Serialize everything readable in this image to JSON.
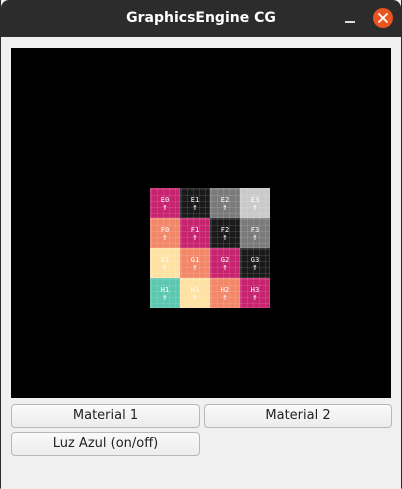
{
  "window": {
    "title": "GraphicsEngine CG"
  },
  "buttons": {
    "material1": "Material 1",
    "material2": "Material 2",
    "luz_azul": "Luz Azul (on/off)"
  },
  "texture_tiles": [
    {
      "code": "E0",
      "color": "#c6246e"
    },
    {
      "code": "E1",
      "color": "#1a1a1a"
    },
    {
      "code": "E2",
      "color": "#7a7a7a"
    },
    {
      "code": "E3",
      "color": "#c9c9c9"
    },
    {
      "code": "F0",
      "color": "#f2886a"
    },
    {
      "code": "F1",
      "color": "#c6246e"
    },
    {
      "code": "F2",
      "color": "#1a1a1a"
    },
    {
      "code": "F3",
      "color": "#7a7a7a"
    },
    {
      "code": "G1",
      "color": "#fde2a4"
    },
    {
      "code": "G1",
      "color": "#f2886a"
    },
    {
      "code": "G2",
      "color": "#c6246e"
    },
    {
      "code": "G3",
      "color": "#1a1a1a"
    },
    {
      "code": "H1",
      "color": "#5ec7b0"
    },
    {
      "code": "H1",
      "color": "#fde2a4"
    },
    {
      "code": "H2",
      "color": "#f2886a"
    },
    {
      "code": "H3",
      "color": "#c6246e"
    }
  ],
  "colors": {
    "titlebar": "#2c2c2c",
    "close_button": "#e95420",
    "viewport_background": "#000000"
  }
}
